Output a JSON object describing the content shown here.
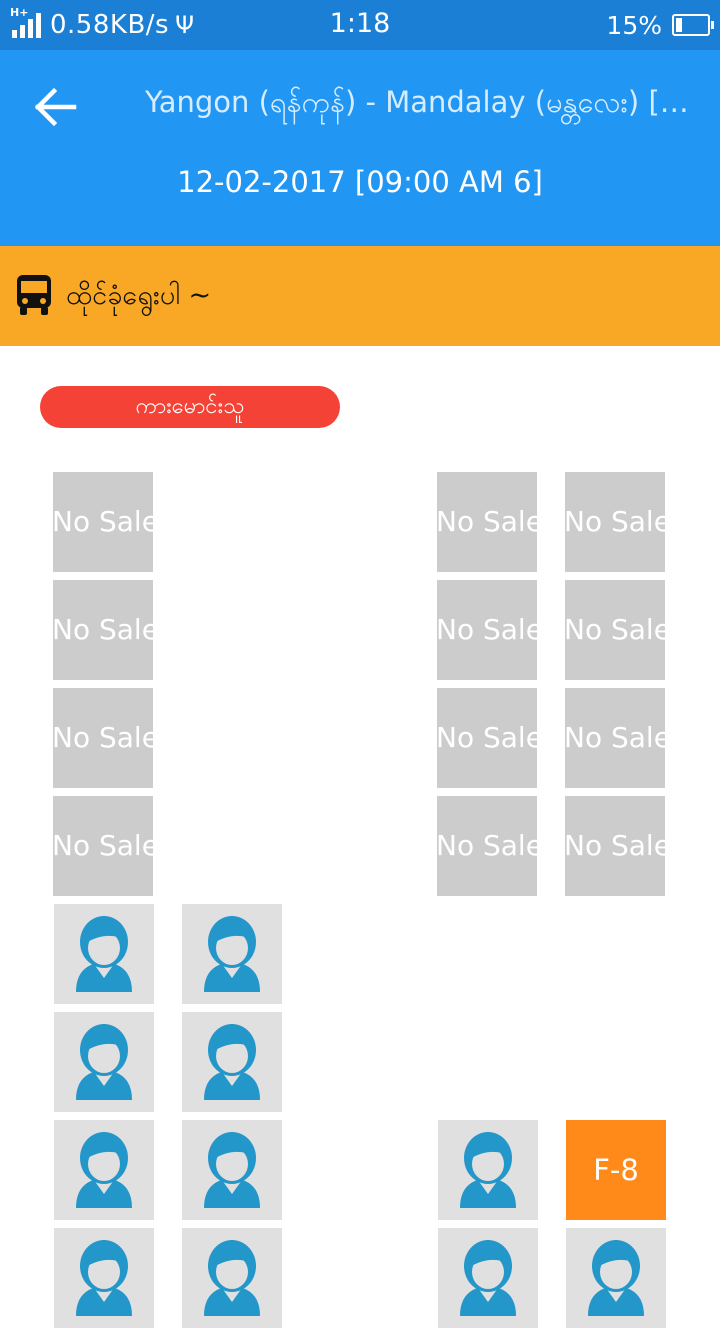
{
  "status_bar": {
    "network": "H+",
    "speed": "0.58KB/s",
    "time": "1:18",
    "battery": "15%"
  },
  "header": {
    "route": "Yangon (ရန်ကုန်) - Mandalay (မန္တလေး) [GI ...",
    "datetime": "12-02-2017 [09:00 AM 6]"
  },
  "seat_bar": {
    "label": "ထိုင်ခုံရွေးပါ ~"
  },
  "driver_label": "ကားမောင်းသူ",
  "seats": {
    "no_sale_label": "No Sale",
    "available_seat": "F-8"
  },
  "colors": {
    "status_bar": "#1c7fd6",
    "app_bar": "#2196f3",
    "seat_bar": "#f9a825",
    "driver_badge": "#f44336",
    "no_sale": "#cccccc",
    "taken": "#e0e0e0",
    "available": "#ff8a1a",
    "person_icon": "#2397c9"
  }
}
